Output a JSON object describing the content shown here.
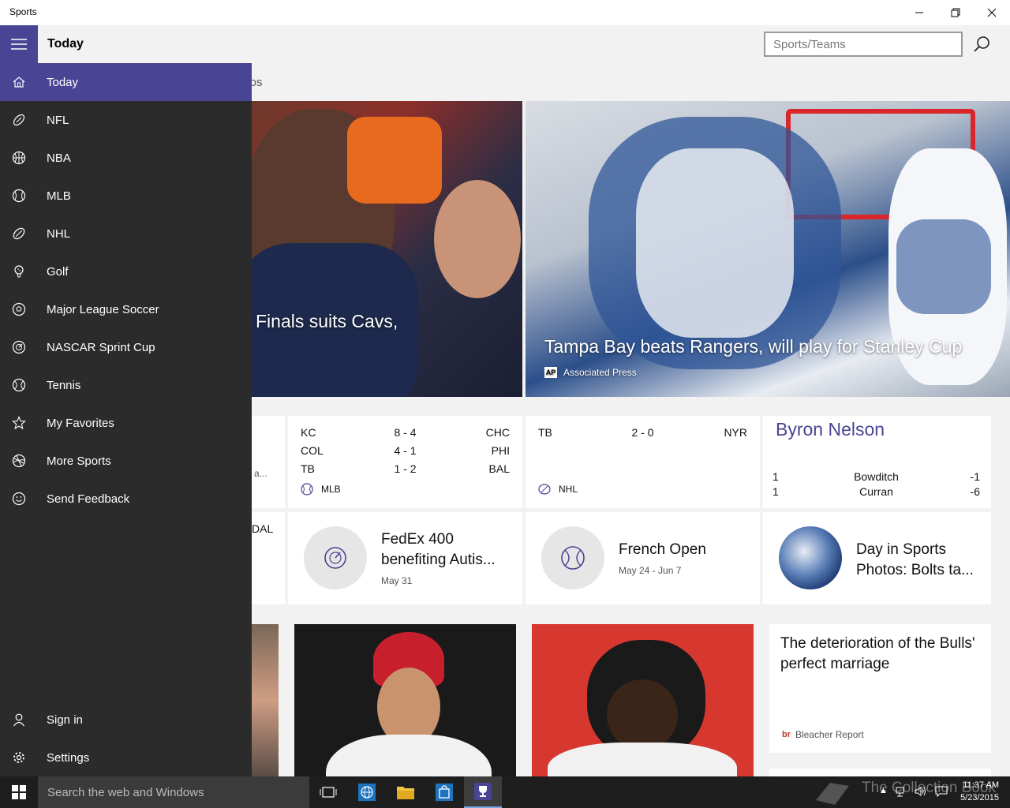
{
  "window": {
    "title": "Sports"
  },
  "header": {
    "page_title": "Today",
    "search_placeholder": "Sports/Teams",
    "partial_tab": "deos"
  },
  "nav": {
    "items": [
      {
        "label": "Today",
        "icon": "home-icon",
        "active": true
      },
      {
        "label": "NFL",
        "icon": "football-icon"
      },
      {
        "label": "NBA",
        "icon": "basketball-icon"
      },
      {
        "label": "MLB",
        "icon": "baseball-icon"
      },
      {
        "label": "NHL",
        "icon": "hockey-icon"
      },
      {
        "label": "Golf",
        "icon": "golf-icon"
      },
      {
        "label": "Major League Soccer",
        "icon": "soccer-icon"
      },
      {
        "label": "NASCAR Sprint Cup",
        "icon": "nascar-icon"
      },
      {
        "label": "Tennis",
        "icon": "tennis-icon"
      },
      {
        "label": "My Favorites",
        "icon": "star-icon"
      },
      {
        "label": "More Sports",
        "icon": "more-sports-icon"
      },
      {
        "label": "Send Feedback",
        "icon": "smiley-icon"
      }
    ],
    "bottom": [
      {
        "label": "Sign in",
        "icon": "person-icon"
      },
      {
        "label": "Settings",
        "icon": "gear-icon"
      }
    ]
  },
  "hero": {
    "left": {
      "headline": "Finals suits Cavs,"
    },
    "right": {
      "headline": "Tampa Bay beats Rangers, will play for Stanley Cup",
      "source": "Associated Press",
      "source_logo": "AP"
    }
  },
  "scores": {
    "partial_left": {
      "text": "a...",
      "team": "DAL"
    },
    "mlb": {
      "league": "MLB",
      "games": [
        {
          "t1": "KC",
          "score": "8  -  4",
          "t2": "CHC"
        },
        {
          "t1": "COL",
          "score": "4  -  1",
          "t2": "PHI"
        },
        {
          "t1": "TB",
          "score": "1  -  2",
          "t2": "BAL"
        }
      ]
    },
    "nhl": {
      "league": "NHL",
      "games": [
        {
          "t1": "TB",
          "score": "2  -  0",
          "t2": "NYR"
        }
      ]
    },
    "golf": {
      "title": "Byron Nelson",
      "rows": [
        {
          "pos": "1",
          "name": "Bowditch",
          "score": "-1"
        },
        {
          "pos": "1",
          "name": "Curran",
          "score": "-6"
        }
      ]
    }
  },
  "events": [
    {
      "title": "FedEx 400 benefiting Autis...",
      "date": "May 31",
      "icon": "speedometer-icon"
    },
    {
      "title": "French Open",
      "date": "May 24 - Jun 7",
      "icon": "tennis-ball-icon"
    },
    {
      "title": "Day in Sports Photos: Bolts ta...",
      "date": "",
      "icon": "photo-thumbnail"
    }
  ],
  "articles": [
    {
      "title": "The deterioration of the Bulls' perfect marriage",
      "source": "Bleacher Report",
      "source_logo": "br"
    }
  ],
  "taskbar": {
    "search_placeholder": "Search the web and Windows",
    "watermark": "The Collection Book",
    "time": "11:37 AM",
    "date": "5/23/2015"
  },
  "colors": {
    "accent": "#4a4494",
    "nav_bg": "#2b2b2b",
    "taskbar_bg": "#1e1e1e"
  }
}
